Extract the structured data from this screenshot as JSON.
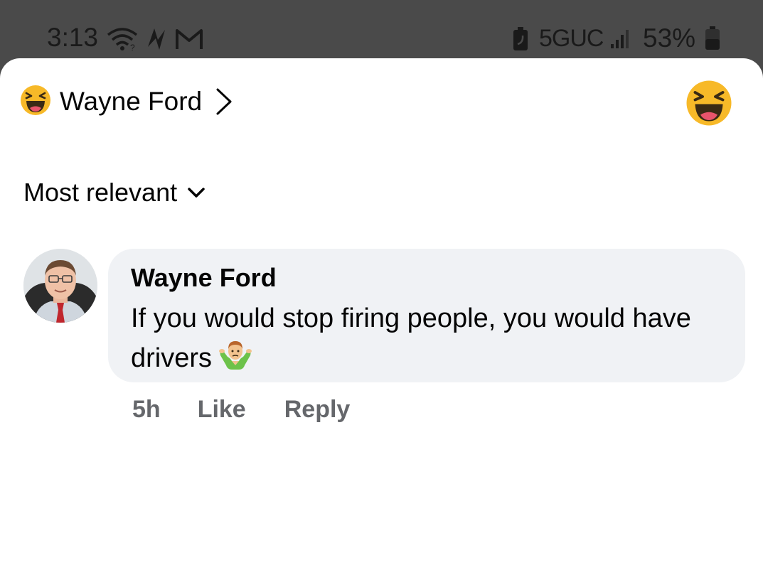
{
  "status_bar": {
    "time": "3:13",
    "network": "5GUC",
    "battery_percent": "53%",
    "icons": [
      "wifi-icon",
      "bolt-icon",
      "gmail-icon",
      "battery-saver-icon",
      "signal-icon",
      "battery-icon"
    ]
  },
  "header": {
    "reactor_name": "Wayne Ford",
    "reaction_icon": "laughing-emoji-icon",
    "chevron_icon": "chevron-right-icon",
    "big_reaction_icon": "laughing-emoji-icon"
  },
  "sort": {
    "label": "Most relevant",
    "chevron_icon": "chevron-down-icon"
  },
  "comment": {
    "author": "Wayne Ford",
    "text": "If you would stop firing people, you would have drivers",
    "emoji_icon": "person-shrugging-icon",
    "time": "5h",
    "like_label": "Like",
    "reply_label": "Reply"
  },
  "colors": {
    "status_bar_bg": "#4a4a4a",
    "sheet_bg": "#ffffff",
    "bubble_bg": "#f0f2f5",
    "text_primary": "#050505",
    "text_secondary": "#65676b",
    "emoji_yellow": "#f7b928"
  }
}
